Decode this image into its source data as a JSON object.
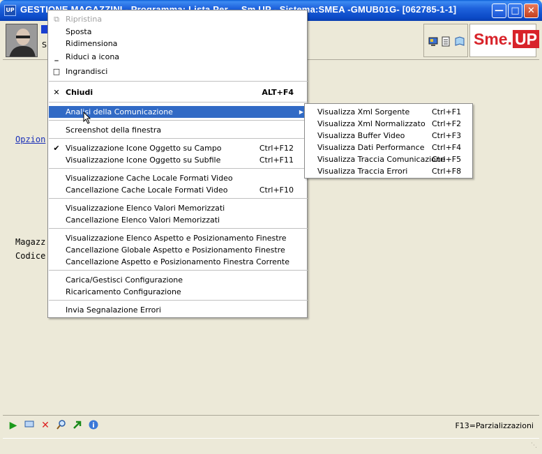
{
  "window": {
    "title": "GESTIONE MAGAZZINI - Programma: Lista Per ... Sm.UP - Sistema:SMEA -GMUB01G- [062785-1-1]",
    "app_icon": "UP",
    "controls": [
      "minimize-icon",
      "maximize-icon",
      "close-icon"
    ]
  },
  "header": {
    "field_label": "S",
    "logo_left": "Sme.",
    "logo_right": "UP"
  },
  "main": {
    "link_partial": "Opzion",
    "label_magazz": "Magazz",
    "label_codice": "Codice"
  },
  "system_menu": {
    "items": [
      {
        "label": "Ripristina",
        "disabled": true,
        "icon": "restore-icon"
      },
      {
        "label": "Sposta"
      },
      {
        "label": "Ridimensiona"
      },
      {
        "label": "Riduci a icona",
        "icon": "minimize-icon"
      },
      {
        "label": "Ingrandisci",
        "icon": "maximize-icon"
      },
      {
        "label": "Chiudi",
        "accel": "ALT+F4",
        "icon": "close-icon",
        "bold": true
      },
      {
        "label": "Analisi della Comunicazione",
        "selected": true,
        "submenu": true
      },
      {
        "label": "Screenshot della finestra"
      },
      {
        "label": "Visualizzazione Icone Oggetto su Campo",
        "accel": "Ctrl+F12",
        "checked": true
      },
      {
        "label": "Visualizzazione Icone Oggetto su Subfile",
        "accel": "Ctrl+F11"
      },
      {
        "label": "Visualizzazione Cache Locale Formati Video"
      },
      {
        "label": "Cancellazione Cache Locale Formati Video",
        "accel": "Ctrl+F10"
      },
      {
        "label": "Visualizzazione Elenco Valori Memorizzati"
      },
      {
        "label": "Cancellazione Elenco Valori Memorizzati"
      },
      {
        "label": "Visualizzazione Elenco Aspetto e Posizionamento Finestre"
      },
      {
        "label": "Cancellazione Globale Aspetto e Posizionamento Finestre"
      },
      {
        "label": "Cancellazione Aspetto e Posizionamento Finestra Corrente"
      },
      {
        "label": "Carica/Gestisci Configurazione"
      },
      {
        "label": "Ricaricamento Configurazione"
      },
      {
        "label": "Invia Segnalazione Errori"
      }
    ]
  },
  "submenu": {
    "items": [
      {
        "label": "Visualizza Xml Sorgente",
        "accel": "Ctrl+F1"
      },
      {
        "label": "Visualizza Xml Normalizzato",
        "accel": "Ctrl+F2"
      },
      {
        "label": "Visualizza Buffer Video",
        "accel": "Ctrl+F3"
      },
      {
        "label": "Visualizza Dati Performance",
        "accel": "Ctrl+F4"
      },
      {
        "label": "Visualizza Traccia Comunicazione",
        "accel": "Ctrl+F5"
      },
      {
        "label": "Visualizza Traccia Errori",
        "accel": "Ctrl+F8"
      }
    ]
  },
  "bottom_toolbar": {
    "icons": [
      "play-icon",
      "window-icon",
      "delete-icon",
      "search-icon",
      "export-icon",
      "info-icon"
    ],
    "function_key_hint": "F13=Parzializzazioni"
  },
  "colors": {
    "titlebar": "#0b49c6",
    "menu_highlight": "#316ac5",
    "logo_red": "#d8232a",
    "link_blue": "#1a2fb8"
  }
}
